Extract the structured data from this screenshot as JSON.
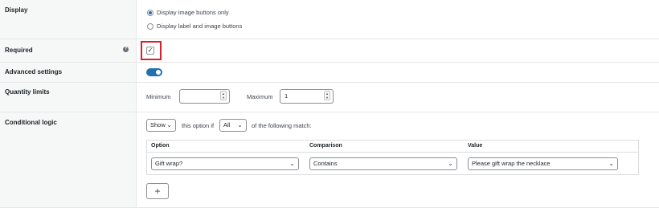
{
  "display": {
    "label": "Display",
    "options": [
      {
        "label": "Display image buttons only",
        "selected": true
      },
      {
        "label": "Display label and image buttons",
        "selected": false
      }
    ]
  },
  "required": {
    "label": "Required",
    "checked": true,
    "help_icon": "question-circle-icon",
    "check_mark": "✓",
    "help_glyph": "?"
  },
  "advanced": {
    "label": "Advanced settings",
    "enabled": true
  },
  "quantity": {
    "label": "Quantity limits",
    "min_label": "Minimum",
    "min_value": "",
    "max_label": "Maximum",
    "max_value": "1"
  },
  "conditional": {
    "label": "Conditional logic",
    "action_select": "Show",
    "text_1": "this option if",
    "match_select": "All",
    "text_2": "of the following match:",
    "columns": [
      "Option",
      "Comparison",
      "Value"
    ],
    "rule": {
      "option": "Gift wrap?",
      "comparison": "Contains",
      "value": "Please gift wrap the necklace"
    },
    "add_label": "+"
  },
  "colors": {
    "accent": "#2271b1",
    "highlight": "#d6212a",
    "label_bg": "#f6f7f7"
  }
}
